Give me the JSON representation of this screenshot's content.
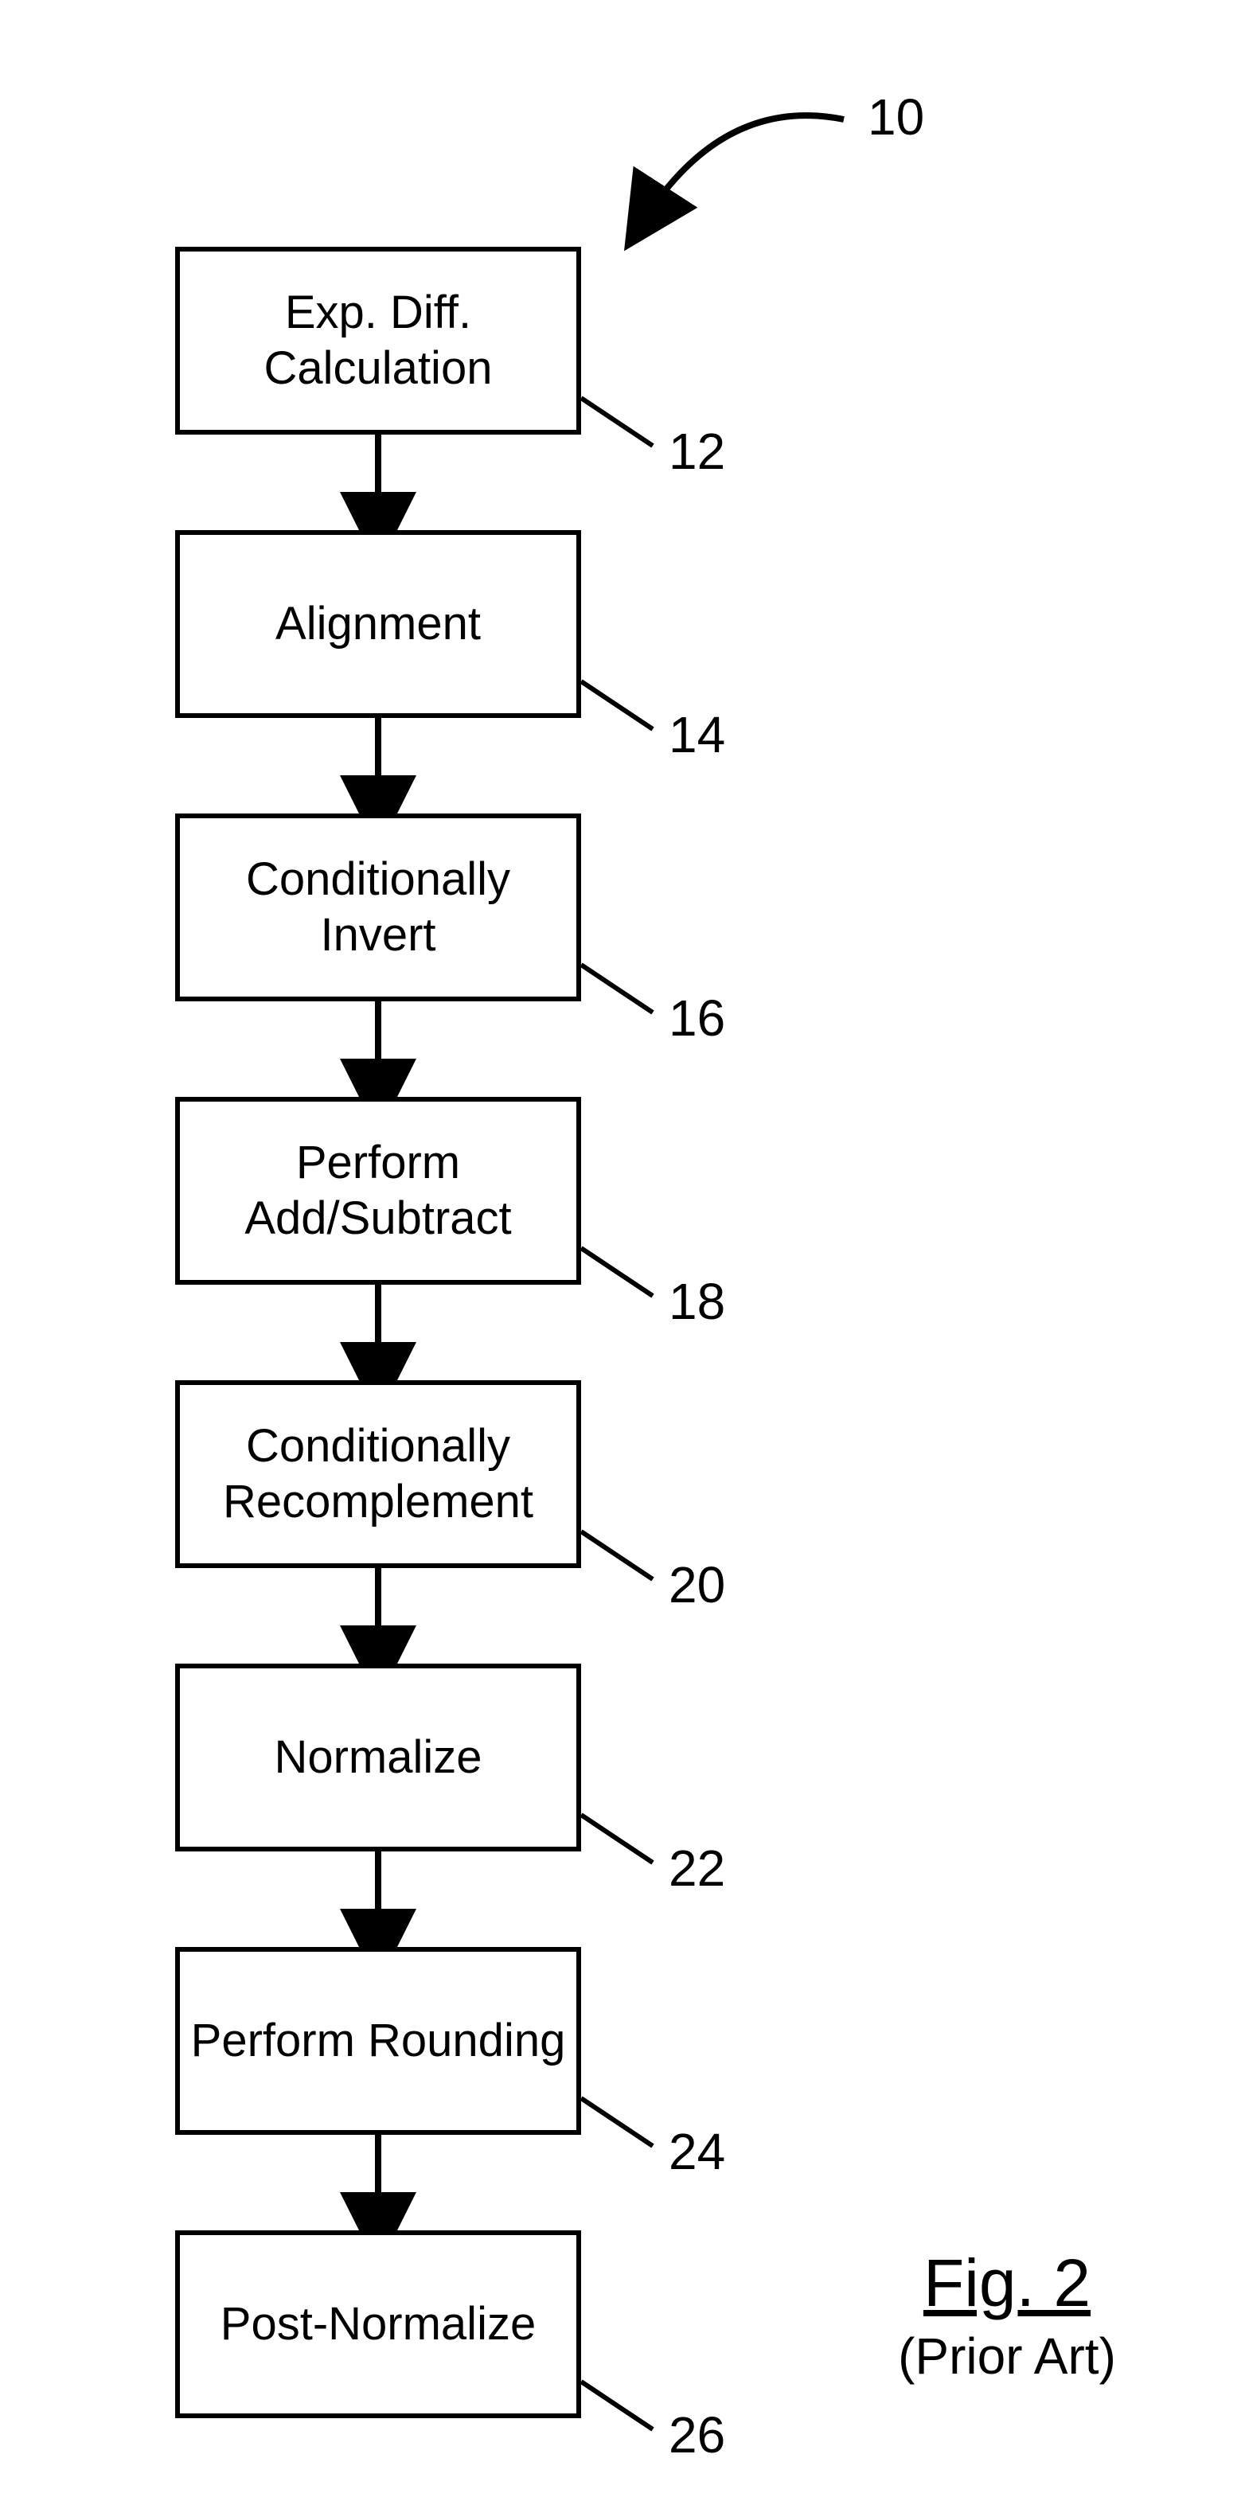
{
  "title_number": "10",
  "figure": {
    "title": "Fig. 2",
    "subtitle": "(Prior Art)"
  },
  "steps": [
    {
      "label": "Exp. Diff.\nCalculation",
      "num": "12"
    },
    {
      "label": "Alignment",
      "num": "14"
    },
    {
      "label": "Conditionally\nInvert",
      "num": "16"
    },
    {
      "label": "Perform\nAdd/Subtract",
      "num": "18"
    },
    {
      "label": "Conditionally\nRecomplement",
      "num": "20"
    },
    {
      "label": "Normalize",
      "num": "22"
    },
    {
      "label": "Perform Rounding",
      "num": "24"
    },
    {
      "label": "Post-Normalize",
      "num": "26"
    }
  ]
}
